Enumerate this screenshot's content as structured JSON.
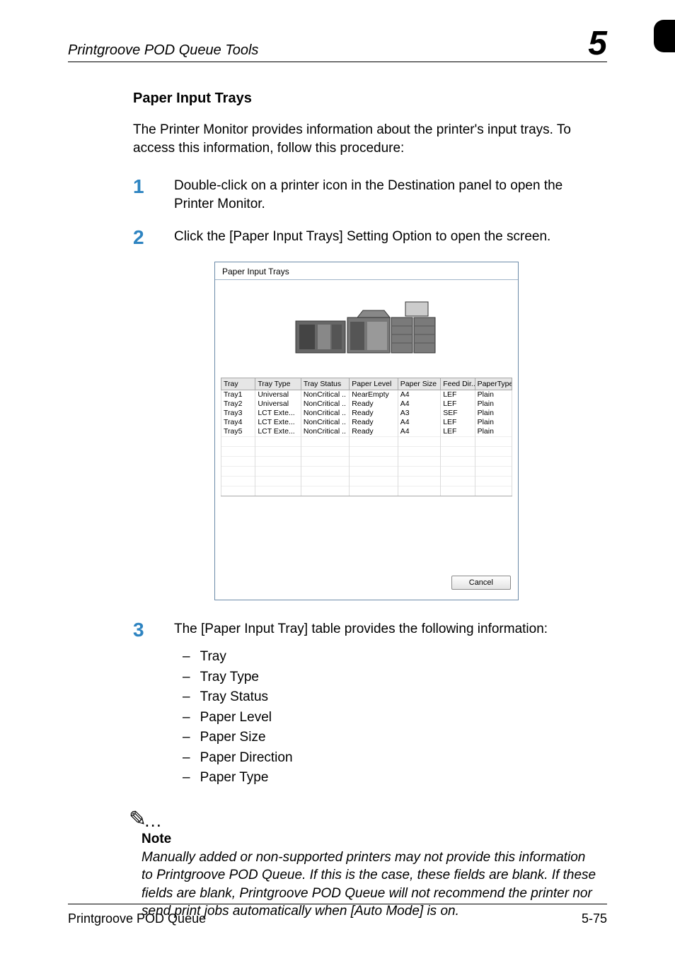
{
  "header": {
    "tool_title": "Printgroove POD Queue Tools",
    "chapter_number": "5"
  },
  "section": {
    "title": "Paper Input Trays",
    "intro": "The Printer Monitor provides information about the printer's input trays. To access this information, follow this procedure:"
  },
  "steps": {
    "s1": {
      "num": "1",
      "text": "Double-click on a printer icon in the Destination panel to open the Printer Monitor."
    },
    "s2": {
      "num": "2",
      "text": "Click the [Paper Input Trays] Setting Option to open the screen."
    },
    "s3": {
      "num": "3",
      "text": "The [Paper Input Tray] table provides the following information:"
    }
  },
  "dialog": {
    "title": "Paper Input Trays",
    "headers": {
      "tray": "Tray",
      "tray_type": "Tray Type",
      "tray_status": "Tray Status",
      "paper_level": "Paper Level",
      "paper_size": "Paper Size",
      "feed_dir": "Feed Dir...",
      "paper_type": "PaperType"
    },
    "rows": [
      {
        "tray": "Tray1",
        "tray_type": "Universal",
        "tray_status": "NonCritical ..",
        "paper_level": "NearEmpty",
        "paper_size": "A4",
        "feed_dir": "LEF",
        "paper_type": "Plain"
      },
      {
        "tray": "Tray2",
        "tray_type": "Universal",
        "tray_status": "NonCritical ..",
        "paper_level": "Ready",
        "paper_size": "A4",
        "feed_dir": "LEF",
        "paper_type": "Plain"
      },
      {
        "tray": "Tray3",
        "tray_type": "LCT Exte...",
        "tray_status": "NonCritical ..",
        "paper_level": "Ready",
        "paper_size": "A3",
        "feed_dir": "SEF",
        "paper_type": "Plain"
      },
      {
        "tray": "Tray4",
        "tray_type": "LCT Exte...",
        "tray_status": "NonCritical ..",
        "paper_level": "Ready",
        "paper_size": "A4",
        "feed_dir": "LEF",
        "paper_type": "Plain"
      },
      {
        "tray": "Tray5",
        "tray_type": "LCT Exte...",
        "tray_status": "NonCritical ..",
        "paper_level": "Ready",
        "paper_size": "A4",
        "feed_dir": "LEF",
        "paper_type": "Plain"
      }
    ],
    "cancel_label": "Cancel"
  },
  "info_fields": {
    "f1": "Tray",
    "f2": "Tray Type",
    "f3": "Tray Status",
    "f4": "Paper Level",
    "f5": "Paper Size",
    "f6": "Paper Direction",
    "f7": "Paper Type"
  },
  "note": {
    "label": "Note",
    "body": "Manually added or non-supported printers may not provide this information to Printgroove POD Queue. If this is the case, these fields are blank. If these fields are blank, Printgroove POD Queue will not recommend the printer nor send print jobs automatically when [Auto Mode] is on."
  },
  "footer": {
    "product": "Printgroove POD Queue",
    "page": "5-75"
  }
}
